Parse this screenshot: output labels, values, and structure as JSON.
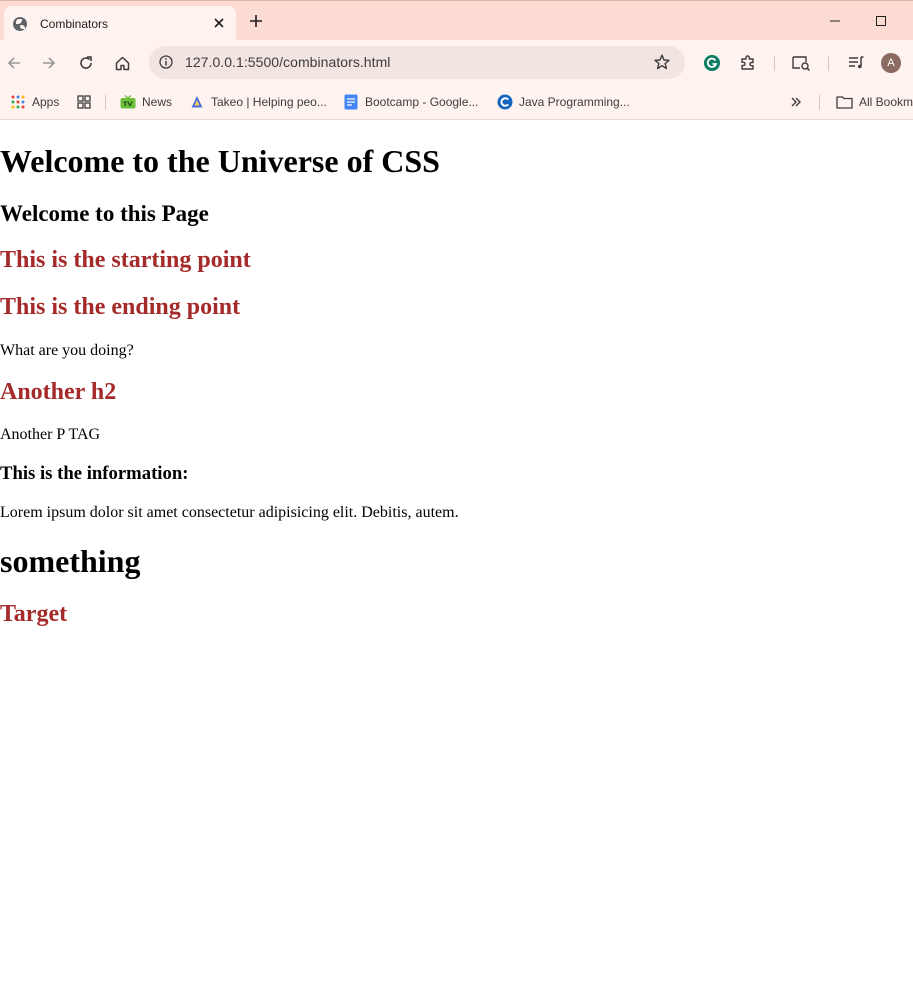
{
  "browser": {
    "tab": {
      "title": "Combinators",
      "close_icon": "close-icon",
      "favicon": "globe-icon"
    },
    "new_tab_icon": "plus-icon",
    "window_controls": [
      "minimize-icon",
      "maximize-icon"
    ],
    "url": "127.0.0.1:5500/combinators.html",
    "bookmarks": [
      {
        "label": "Apps",
        "icon": "apps-grid-icon"
      },
      {
        "label": "",
        "icon": "tab-groups-icon"
      },
      {
        "label": "News",
        "icon": "tv-icon"
      },
      {
        "label": "Takeo | Helping peo...",
        "icon": "takeo-icon"
      },
      {
        "label": "Bootcamp - Google...",
        "icon": "google-docs-icon"
      },
      {
        "label": "Java Programming...",
        "icon": "c-logo-icon"
      }
    ],
    "bookmarks_overflow_icon": "chevron-double-right-icon",
    "all_bookmarks_label": "All Bookm",
    "profile_initial": "A"
  },
  "page": {
    "h1_main": "Welcome to the Universe of CSS",
    "h3_welcome": "Welcome to this Page",
    "h2_start": "This is the starting point",
    "h2_end": "This is the ending point",
    "p_doing": "What are you doing?",
    "h2_another": "Another h2",
    "p_another": "Another P TAG",
    "h4_info": "This is the information:",
    "p_lorem": "Lorem ipsum dolor sit amet consectetur adipisicing elit. Debitis, autem.",
    "h1_something": "something",
    "h2_target": "Target"
  },
  "colors": {
    "tabstrip": "#fcdcd2",
    "toolbar": "#fff3f0",
    "omnibox": "#f2e4e1",
    "heading_red": "#a52a2a"
  }
}
